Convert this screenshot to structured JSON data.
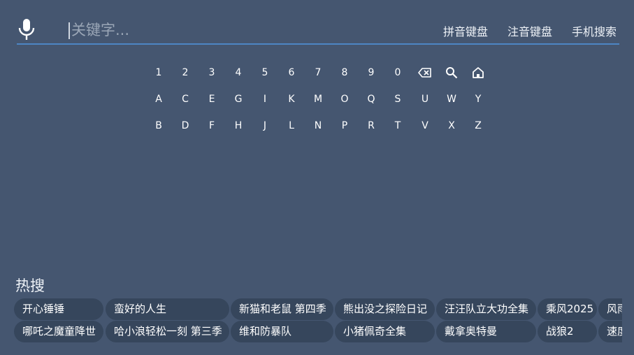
{
  "search": {
    "placeholder": "关键字...",
    "value": "",
    "modes": [
      "拼音键盘",
      "注音键盘",
      "手机搜索"
    ]
  },
  "keyboard": {
    "row1": [
      "1",
      "2",
      "3",
      "4",
      "5",
      "6",
      "7",
      "8",
      "9",
      "0"
    ],
    "row1_icons": [
      "backspace-icon",
      "search-icon",
      "home-icon"
    ],
    "row2": [
      "A",
      "C",
      "E",
      "G",
      "I",
      "K",
      "M",
      "O",
      "Q",
      "S",
      "U",
      "W",
      "Y"
    ],
    "row3": [
      "B",
      "D",
      "F",
      "H",
      "J",
      "L",
      "N",
      "P",
      "R",
      "T",
      "V",
      "X",
      "Z"
    ]
  },
  "hot": {
    "title": "热搜",
    "row1": [
      "开心锤锤",
      "蛮好的人生",
      "新猫和老鼠 第四季",
      "熊出没之探险日记",
      "汪汪队立大功全集",
      "乘风2025",
      "风雨"
    ],
    "row2": [
      "哪吒之魔童降世",
      "哈小浪轻松一刻 第三季",
      "维和防暴队",
      "小猪佩奇全集",
      "戴拿奥特曼",
      "战狼2",
      "速度"
    ]
  },
  "colors": {
    "background": "#455670",
    "underline": "#4d86c4",
    "chip": "#36465c"
  }
}
